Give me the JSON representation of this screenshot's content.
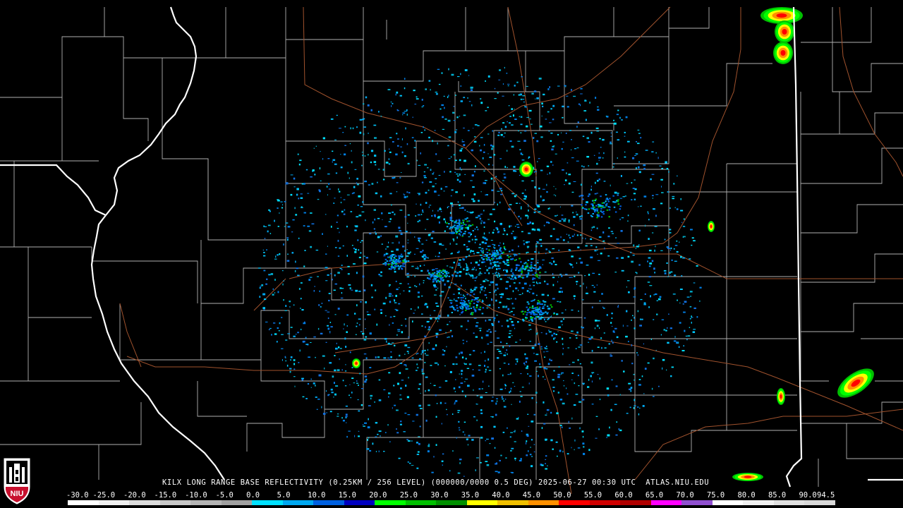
{
  "header": {
    "caption": "KILX LONG RANGE BASE REFLECTIVITY (0.25KM / 256 LEVEL) (000000/0000 0.5 DEG) 2025-06-27 00:30 UTC  ATLAS.NIU.EDU"
  },
  "logo": {
    "text": "NIU",
    "bg_color": "#c8102e"
  },
  "scale": {
    "labels": [
      "-30.0",
      "-25.0",
      "-20.0",
      "-15.0",
      "-10.0",
      "-5.0",
      "0.0",
      "5.0",
      "10.0",
      "15.0",
      "20.0",
      "25.0",
      "30.0",
      "35.0",
      "40.0",
      "45.0",
      "50.0",
      "55.0",
      "60.0",
      "65.0",
      "70.0",
      "75.0",
      "80.0",
      "85.0",
      "90.0",
      "94.5"
    ],
    "colors": [
      "#ffffff",
      "#f0f0f0",
      "#dcdcdc",
      "#c8c8c8",
      "#b4b4b4",
      "#a0a0a0",
      "#00e0ff",
      "#00a8f0",
      "#0060e0",
      "#0000c0",
      "#00ff00",
      "#00c000",
      "#009000",
      "#ffff00",
      "#f0c000",
      "#ff9000",
      "#ff0000",
      "#d00000",
      "#b00000",
      "#ff00ff",
      "#9050d0",
      "#ffffff",
      "#f0f0f0",
      "#e0e0e0",
      "#d8d8d8"
    ]
  },
  "map": {
    "county_color": "#b0b0b0",
    "state_color": "#ffffff",
    "road_color": "#a0522d"
  }
}
